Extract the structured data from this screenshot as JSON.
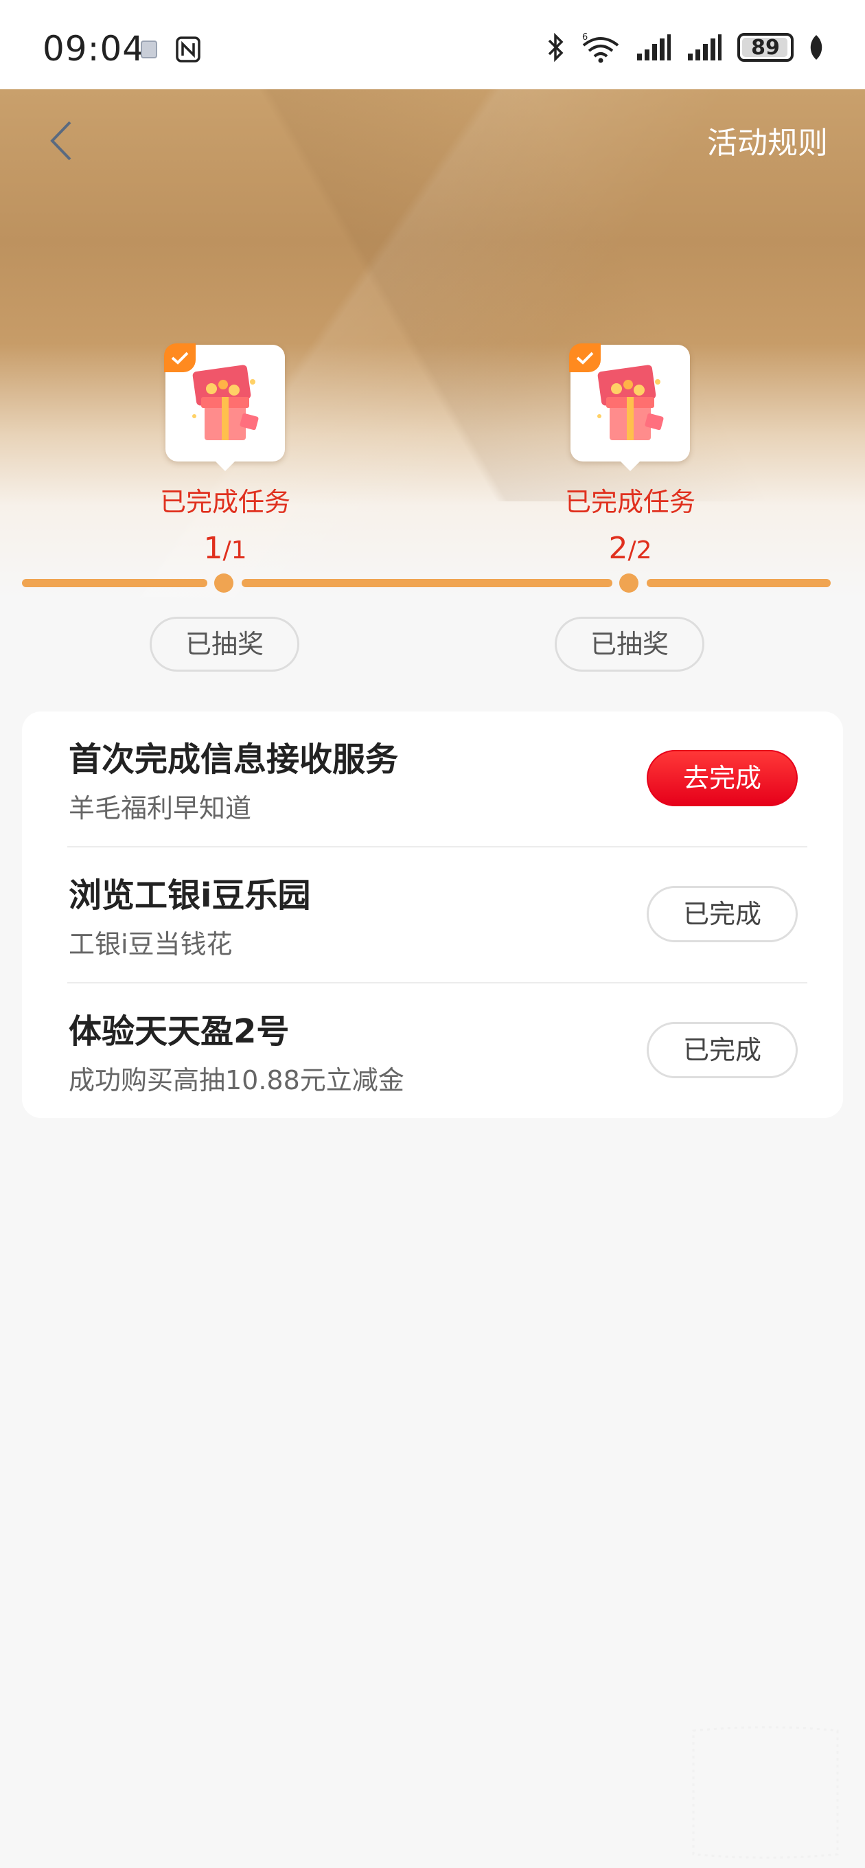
{
  "status_bar": {
    "time": "09:04",
    "battery": "89"
  },
  "header": {
    "rules_label": "活动规则"
  },
  "milestones": [
    {
      "label": "已完成任务",
      "done": "1",
      "total": "/1",
      "button": "已抽奖"
    },
    {
      "label": "已完成任务",
      "done": "2",
      "total": "/2",
      "button": "已抽奖"
    }
  ],
  "tasks": [
    {
      "title": "首次完成信息接收服务",
      "subtitle": "羊毛福利早知道",
      "button": "去完成",
      "state": "todo"
    },
    {
      "title": "浏览工银i豆乐园",
      "subtitle": "工银i豆当钱花",
      "button": "已完成",
      "state": "done"
    },
    {
      "title": "体验天天盈2号",
      "subtitle": "成功购买高抽10.88元立减金",
      "button": "已完成",
      "state": "done"
    }
  ],
  "colors": {
    "accent_red": "#e0301e",
    "progress_orange": "#f0a451",
    "button_red": "#e6001a"
  }
}
